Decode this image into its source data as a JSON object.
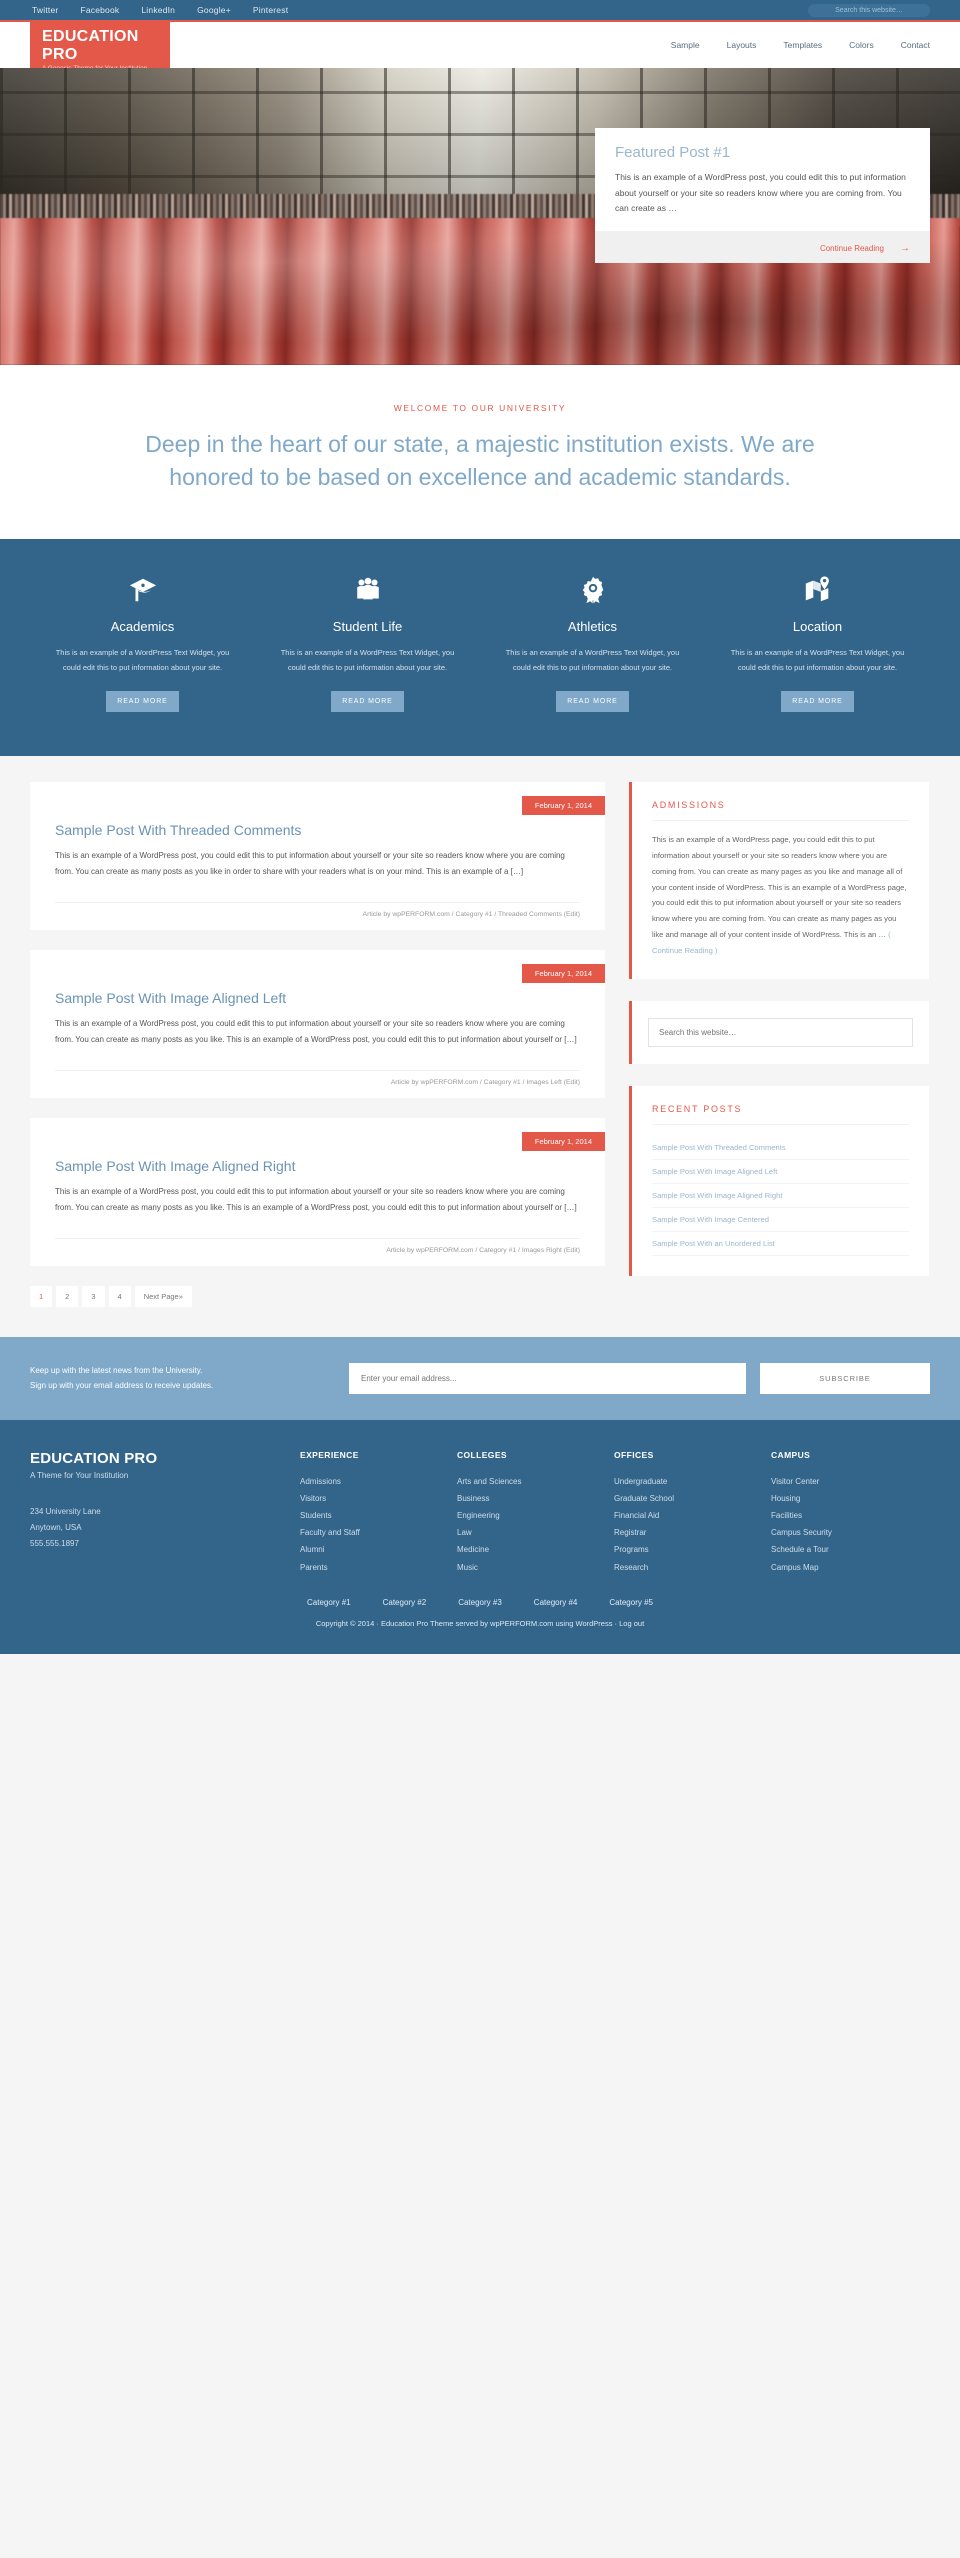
{
  "topbar": {
    "social_links": [
      {
        "label": "Twitter",
        "icon": "twitter-icon"
      },
      {
        "label": "Facebook",
        "icon": "facebook-icon"
      },
      {
        "label": "LinkedIn",
        "icon": "linkedin-icon"
      },
      {
        "label": "Google+",
        "icon": "googleplus-icon"
      },
      {
        "label": "Pinterest",
        "icon": "pinterest-icon"
      }
    ],
    "search_placeholder": "Search this website…"
  },
  "header": {
    "logo_title": "EDUCATION PRO",
    "logo_tagline": "A Genesis Theme for Your Institution",
    "nav": [
      {
        "label": "Sample"
      },
      {
        "label": "Layouts"
      },
      {
        "label": "Templates"
      },
      {
        "label": "Colors"
      },
      {
        "label": "Contact"
      }
    ]
  },
  "hero": {
    "card_title": "Featured Post #1",
    "card_text": "This is an example of a WordPress post, you could edit this to put information about yourself or your site so readers know where you are coming from. You can create as …",
    "cta_label": "Continue Reading",
    "cta_arrow": "→"
  },
  "welcome": {
    "eyebrow": "WELCOME TO OUR UNIVERSITY",
    "headline": "Deep in the heart of our state, a majestic institution exists. We are honored to be based on excellence and academic standards."
  },
  "features": {
    "items": [
      {
        "icon": "graduation-cap-icon",
        "title": "Academics",
        "text": "This is an example of a WordPress Text Widget, you could edit this to put information about your site.",
        "button": "READ MORE"
      },
      {
        "icon": "people-group-icon",
        "title": "Student Life",
        "text": "This is an example of a WordPress Text Widget, you could edit this to put information about your site.",
        "button": "READ MORE"
      },
      {
        "icon": "award-ribbon-icon",
        "title": "Athletics",
        "text": "This is an example of a WordPress Text Widget, you could edit this to put information about your site.",
        "button": "READ MORE"
      },
      {
        "icon": "map-pin-icon",
        "title": "Location",
        "text": "This is an example of a WordPress Text Widget, you could edit this to put information about your site.",
        "button": "READ MORE"
      }
    ]
  },
  "posts": [
    {
      "date": "February 1, 2014",
      "title": "Sample Post With Threaded Comments",
      "excerpt": "This is an example of a WordPress post, you could edit this to put information about yourself or your site so readers know where you are coming from. You can create as many posts as you like in order to share with your readers what is on your mind. This is an example of a […]",
      "meta": "Article by wpPERFORM.com / Category #1 / Threaded Comments (Edit)"
    },
    {
      "date": "February 1, 2014",
      "title": "Sample Post With Image Aligned Left",
      "excerpt": "This is an example of a WordPress post, you could edit this to put information about yourself or your site so readers know where you are coming from. You can create as many posts as you like. This is an example of a WordPress post, you could edit this to put information about yourself or […]",
      "meta": "Article by wpPERFORM.com / Category #1 / Images Left (Edit)"
    },
    {
      "date": "February 1, 2014",
      "title": "Sample Post With Image Aligned Right",
      "excerpt": "This is an example of a WordPress post, you could edit this to put information about yourself or your site so readers know where you are coming from. You can create as many posts as you like. This is an example of a WordPress post, you could edit this to put information about yourself or […]",
      "meta": "Article by wpPERFORM.com / Category #1 / Images Right (Edit)"
    }
  ],
  "pagination": {
    "pages": [
      "1",
      "2",
      "3",
      "4"
    ],
    "active": "1",
    "next_label": "Next Page»"
  },
  "sidebar": {
    "admissions": {
      "title": "ADMISSIONS",
      "text": "This is an example of a WordPress page, you could edit this to put information about yourself or your site so readers know where you are coming from. You can create as many pages as you like and manage all of your content inside of WordPress. This is an example of a WordPress page, you could edit this to put information about yourself or your site so readers know where you are coming from. You can create as many pages as you like and manage all of your content inside of WordPress. This is an … ",
      "continue": "( Continue Reading )"
    },
    "search_placeholder": "Search this website…",
    "recent": {
      "title": "RECENT POSTS",
      "items": [
        {
          "label": "Sample Post With Threaded Comments"
        },
        {
          "label": "Sample Post With Image Aligned Left"
        },
        {
          "label": "Sample Post With Image Aligned Right"
        },
        {
          "label": "Sample Post With Image Centered"
        },
        {
          "label": "Sample Post With an Unordered List"
        }
      ]
    }
  },
  "newsletter": {
    "line1": "Keep up with the latest news from the University.",
    "line2": "Sign up with your email address to receive updates.",
    "input_placeholder": "Enter your email address...",
    "button": "SUBSCRIBE"
  },
  "footer": {
    "brand_title": "EDUCATION PRO",
    "brand_tagline": "A Theme for Your Institution",
    "address_line1": "234 University Lane",
    "address_line2": "Anytown, USA",
    "address_line3": "555.555.1897",
    "columns": [
      {
        "heading": "EXPERIENCE",
        "links": [
          {
            "label": "Admissions"
          },
          {
            "label": "Visitors"
          },
          {
            "label": "Students"
          },
          {
            "label": "Faculty and Staff"
          },
          {
            "label": "Alumni"
          },
          {
            "label": "Parents"
          }
        ]
      },
      {
        "heading": "COLLEGES",
        "links": [
          {
            "label": "Arts and Sciences"
          },
          {
            "label": "Business"
          },
          {
            "label": "Engineering"
          },
          {
            "label": "Law"
          },
          {
            "label": "Medicine"
          },
          {
            "label": "Music"
          }
        ]
      },
      {
        "heading": "OFFICES",
        "links": [
          {
            "label": "Undergraduate"
          },
          {
            "label": "Graduate School"
          },
          {
            "label": "Financial Aid"
          },
          {
            "label": "Registrar"
          },
          {
            "label": "Programs"
          },
          {
            "label": "Research"
          }
        ]
      },
      {
        "heading": "CAMPUS",
        "links": [
          {
            "label": "Visitor Center"
          },
          {
            "label": "Housing"
          },
          {
            "label": "Facilities"
          },
          {
            "label": "Campus Security"
          },
          {
            "label": "Schedule a Tour"
          },
          {
            "label": "Campus Map"
          }
        ]
      }
    ],
    "categories": [
      {
        "label": "Category #1"
      },
      {
        "label": "Category #2"
      },
      {
        "label": "Category #3"
      },
      {
        "label": "Category #4"
      },
      {
        "label": "Category #5"
      }
    ],
    "copyright": "Copyright © 2014 · Education Pro Theme served by wpPERFORM.com using WordPress · Log out"
  },
  "colors": {
    "brand_red": "#e4584a",
    "brand_blue": "#33658a",
    "light_blue": "#7fa8c9"
  }
}
